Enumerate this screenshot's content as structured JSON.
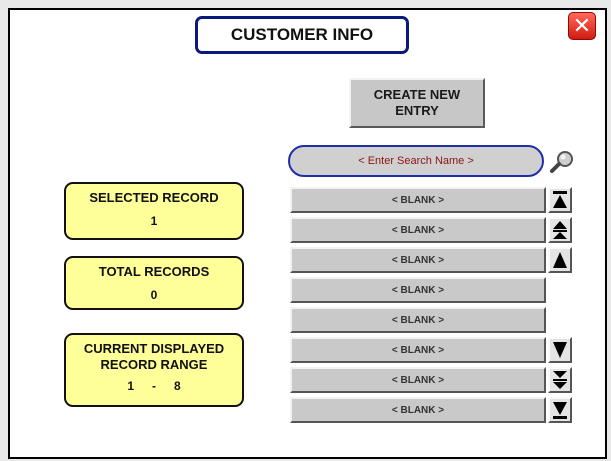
{
  "header": {
    "title": "CUSTOMER INFO"
  },
  "actions": {
    "create_new_entry_line1": "CREATE NEW",
    "create_new_entry_line2": "ENTRY"
  },
  "search": {
    "placeholder": "< Enter Search Name >"
  },
  "selected_record": {
    "label": "SELECTED RECORD",
    "value": "1"
  },
  "total_records": {
    "label": "TOTAL RECORDS",
    "value": "0"
  },
  "displayed_range": {
    "label_line1": "CURRENT DISPLAYED",
    "label_line2": "RECORD RANGE",
    "start": "1",
    "separator": "-",
    "end": "8"
  },
  "records": [
    {
      "label": "< BLANK >"
    },
    {
      "label": "< BLANK >"
    },
    {
      "label": "< BLANK >"
    },
    {
      "label": "< BLANK >"
    },
    {
      "label": "< BLANK >"
    },
    {
      "label": "< BLANK >"
    },
    {
      "label": "< BLANK >"
    },
    {
      "label": "< BLANK >"
    }
  ],
  "scroll_icons": [
    "scroll-top-icon",
    "page-up-icon",
    "line-up-icon",
    "line-down-icon",
    "page-down-icon",
    "scroll-bottom-icon"
  ],
  "colors": {
    "info_box_fill": "#ffff99",
    "title_border": "#0b1a7a",
    "search_border": "#1d2fa8",
    "close_red": "#d31a10",
    "row_gray": "#c9c9c9"
  }
}
